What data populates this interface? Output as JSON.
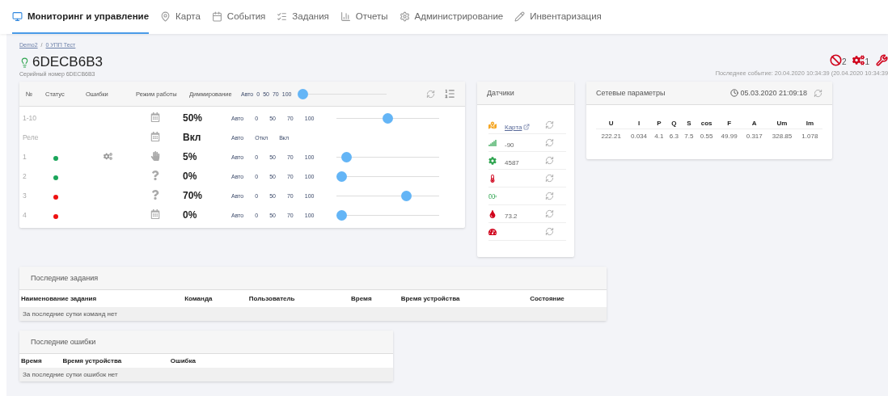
{
  "nav": [
    {
      "kind": "monitor",
      "label": "Мониторинг и управление",
      "selected": true
    },
    {
      "kind": "pin",
      "label": "Карта",
      "selected": false
    },
    {
      "kind": "calendar",
      "label": "События",
      "selected": false
    },
    {
      "kind": "list",
      "label": "Задания",
      "selected": false
    },
    {
      "kind": "chart",
      "label": "Отчеты",
      "selected": false
    },
    {
      "kind": "gear",
      "label": "Администрирование",
      "selected": false
    },
    {
      "kind": "pencil",
      "label": "Инвентаризация",
      "selected": false
    }
  ],
  "breadcrumb": {
    "items": [
      "Demo2",
      "0 УПП Тест"
    ],
    "separator": "/"
  },
  "device": {
    "title": "6DECB6B3",
    "serial": "Серийный номер 6DECB6B3",
    "last_event": "Последнее событие: 20.04.2020 10:34:39 (20.04.2020 10:34:39"
  },
  "alerts": [
    {
      "kind": "ban",
      "count": "2"
    },
    {
      "kind": "gears",
      "count": "1"
    },
    {
      "kind": "wrench"
    }
  ],
  "control": {
    "columns": [
      "№",
      "Статус",
      "Ошибки",
      "Режим работы",
      "Диммирование"
    ],
    "header_options": [
      "Авто",
      "0",
      "50",
      "70",
      "100"
    ],
    "header_slider": {
      "level": 0
    },
    "rows": [
      {
        "num": "1-10",
        "kind": "schedule",
        "value": "50%",
        "options": [
          "Авто",
          "0",
          "50",
          "70",
          "100"
        ],
        "level": 0.5
      },
      {
        "num": "Реле",
        "kind": "schedule",
        "value": "Вкл",
        "options": [
          "Авто",
          "Откл",
          "Вкл"
        ]
      },
      {
        "num": "1",
        "color": "#1aa55a",
        "errors": true,
        "kind": "manual",
        "value": "5%",
        "options": [
          "Авто",
          "0",
          "50",
          "70",
          "100"
        ],
        "level": 0.05
      },
      {
        "num": "2",
        "color": "#1aa55a",
        "errors": false,
        "kind": "unknown",
        "value": "0%",
        "options": [
          "Авто",
          "0",
          "50",
          "70",
          "100"
        ],
        "level": 0
      },
      {
        "num": "3",
        "color": "#ee1111",
        "errors": false,
        "kind": "unknown",
        "value": "70%",
        "options": [
          "Авто",
          "0",
          "50",
          "70",
          "100"
        ],
        "level": 0.7
      },
      {
        "num": "4",
        "color": "#ee1111",
        "errors": false,
        "kind": "schedule",
        "value": "0%",
        "options": [
          "Авто",
          "0",
          "50",
          "70",
          "100"
        ],
        "level": 0
      }
    ]
  },
  "sensors": {
    "title": "Датчики",
    "rows": [
      {
        "kind": "map",
        "link": "Карта"
      },
      {
        "kind": "signal",
        "value": "-90"
      },
      {
        "kind": "gear",
        "value": "4587"
      },
      {
        "kind": "thermometer"
      },
      {
        "kind": "battery"
      },
      {
        "kind": "drop",
        "value": "73.2"
      },
      {
        "kind": "gauge"
      }
    ]
  },
  "network": {
    "title": "Сетевые параметры",
    "time": "05.03.2020 21:09:18",
    "columns": [
      "U",
      "I",
      "P",
      "Q",
      "S",
      "cos",
      "F",
      "A",
      "Um",
      "Im"
    ],
    "values": [
      "222.21",
      "0.034",
      "4.1",
      "6.3",
      "7.5",
      "0.55",
      "49.99",
      "0.317",
      "328.85",
      "1.078"
    ]
  },
  "tasks": {
    "title": "Последние задания",
    "columns": [
      "Наименование задания",
      "Команда",
      "Пользователь",
      "Время",
      "Время устройства",
      "Состояние"
    ],
    "empty": "За последние сутки команд нет"
  },
  "errors": {
    "title": "Последние ошибки",
    "columns": [
      "Время",
      "Время устройства",
      "Ошибка"
    ],
    "empty": "За последние сутки ошибок нет"
  }
}
